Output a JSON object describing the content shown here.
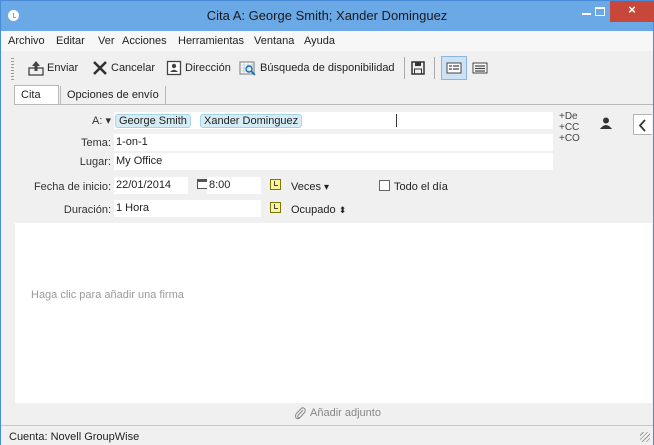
{
  "window": {
    "title": "Cita A: George Smith; Xander Dominguez",
    "minimize": "−",
    "close": "×"
  },
  "menu": {
    "items": [
      "Archivo",
      "Editar",
      "Ver",
      "Acciones",
      "Herramientas",
      "Ventana",
      "Ayuda"
    ]
  },
  "toolbar": {
    "send_label": "Enviar",
    "cancel_label": "Cancelar",
    "address_label": "Dirección",
    "availability_label": "Búsqueda de disponibilidad"
  },
  "tabs": [
    {
      "label": "Cita",
      "active": true
    },
    {
      "label": "Opciones de envío",
      "active": false
    }
  ],
  "form": {
    "to_label": "A:",
    "recipients": [
      "George Smith",
      "Xander Dominguez"
    ],
    "subject_label": "Tema:",
    "subject_value": "1-on-1",
    "place_label": "Lugar:",
    "place_value": "My Office",
    "start_label": "Fecha de inicio:",
    "start_date": "22/01/2014",
    "start_time": "8:00",
    "repeat_label": "Veces",
    "all_day_label": "Todo el día",
    "duration_label": "Duración:",
    "duration_value": "1 Hora",
    "busy_label": "Ocupado",
    "add_from": "+De",
    "add_cc": "+CC",
    "add_bc": "+CO"
  },
  "body": {
    "signature_hint": "Haga clic para añadir una firma"
  },
  "attachment": {
    "label": "Añadir adjunto"
  },
  "status": {
    "account": "Cuenta: Novell GroupWise"
  }
}
